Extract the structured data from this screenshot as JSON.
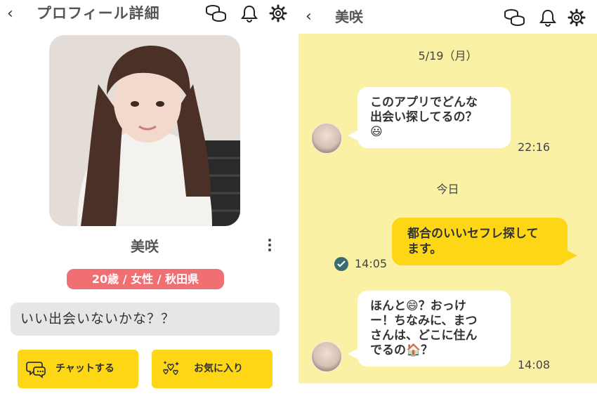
{
  "profile": {
    "back_icon": "‹",
    "title": "プロフィール詳細",
    "name": "美咲",
    "tag": "20歳 / 女性 / 秋田県",
    "bio": "いい出会いないかな？？",
    "buttons": {
      "chat_label": "チャットする",
      "fav_label": "お気に入り"
    },
    "icons": [
      "back-icon",
      "coins-icon",
      "bell-icon",
      "gear-icon",
      "kebab-menu-icon",
      "chat-bubble-icon",
      "hearts-icon"
    ]
  },
  "chat": {
    "back_icon": "‹",
    "title": "美咲",
    "dates": [
      "5/19（月）",
      "今日"
    ],
    "messages": [
      {
        "direction": "in",
        "lines": [
          "このアプリでどんな",
          "出会い探してるの？"
        ],
        "emoji": "😃",
        "time": "22:16"
      },
      {
        "direction": "out",
        "lines": [
          "都合のいいセフレ探して",
          "ます。"
        ],
        "time": "14:05",
        "read": true
      },
      {
        "direction": "in",
        "lines": [
          "ほんと😄？おっけ",
          "ー！ちなみに、まつ",
          "さんは、どこに住ん",
          "でるの🏠？"
        ],
        "time": "14:08"
      }
    ]
  },
  "colors": {
    "accent_yellow": "#fdd615",
    "chat_background": "#faf1a4",
    "tag_red": "#f06f73",
    "bio_gray": "#e6e6e6",
    "read_check": "#3b6a70"
  }
}
